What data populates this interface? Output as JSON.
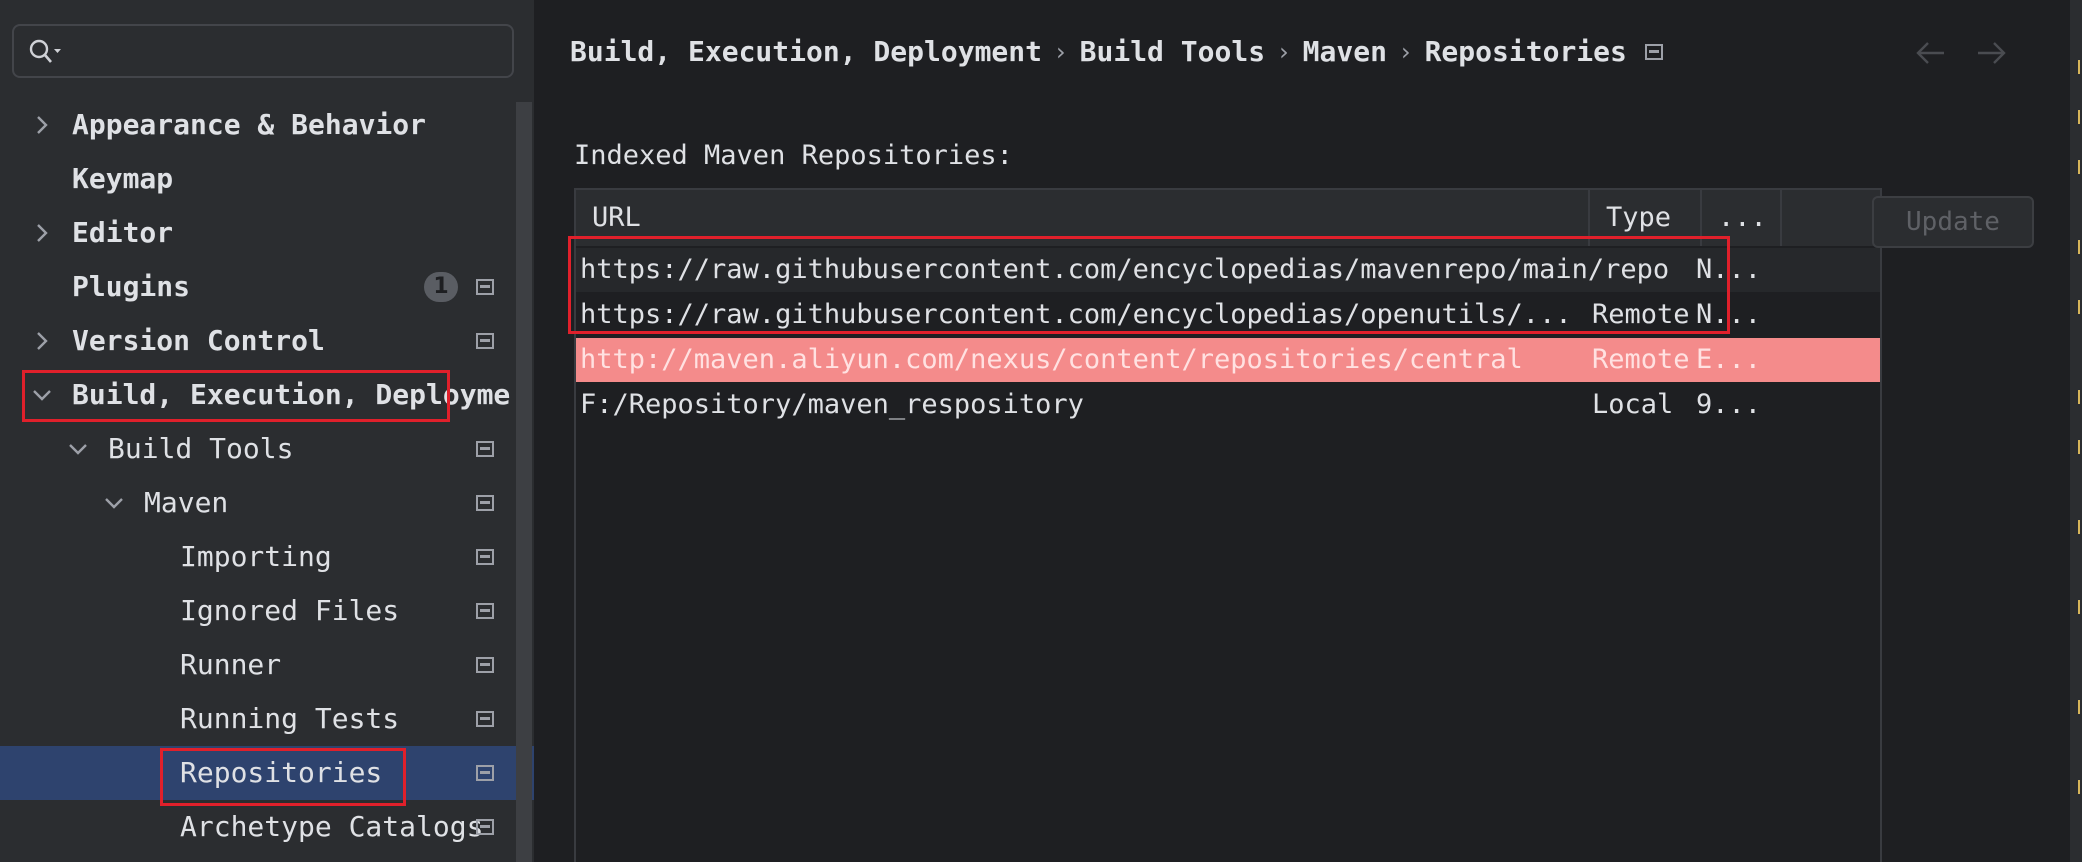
{
  "search": {
    "placeholder": ""
  },
  "tree": [
    {
      "label": "Appearance & Behavior",
      "bold": true,
      "chevron": "right",
      "level": 0
    },
    {
      "label": "Keymap",
      "bold": true,
      "chevron": "none",
      "level": 0
    },
    {
      "label": "Editor",
      "bold": true,
      "chevron": "right",
      "level": 0
    },
    {
      "label": "Plugins",
      "bold": true,
      "chevron": "none",
      "level": 0,
      "badge": "1",
      "pref": true
    },
    {
      "label": "Version Control",
      "bold": true,
      "chevron": "right",
      "level": 0,
      "pref": true
    },
    {
      "label": "Build, Execution, Deployme",
      "bold": true,
      "chevron": "down",
      "level": 0
    },
    {
      "label": "Build Tools",
      "bold": false,
      "chevron": "down",
      "level": 1,
      "pref": true
    },
    {
      "label": "Maven",
      "bold": false,
      "chevron": "down",
      "level": 2,
      "pref": true
    },
    {
      "label": "Importing",
      "bold": false,
      "chevron": "none",
      "level": 3,
      "pref": true
    },
    {
      "label": "Ignored Files",
      "bold": false,
      "chevron": "none",
      "level": 3,
      "pref": true
    },
    {
      "label": "Runner",
      "bold": false,
      "chevron": "none",
      "level": 3,
      "pref": true
    },
    {
      "label": "Running Tests",
      "bold": false,
      "chevron": "none",
      "level": 3,
      "pref": true
    },
    {
      "label": "Repositories",
      "bold": false,
      "chevron": "none",
      "level": 3,
      "pref": true,
      "selected": true
    },
    {
      "label": "Archetype Catalogs",
      "bold": false,
      "chevron": "none",
      "level": 3,
      "pref": true
    }
  ],
  "breadcrumb": [
    "Build, Execution, Deployment",
    "Build Tools",
    "Maven",
    "Repositories"
  ],
  "section_label": "Indexed Maven Repositories:",
  "table": {
    "headers": [
      "URL",
      "Type",
      "..."
    ],
    "rows": [
      {
        "url": "https://raw.githubusercontent.com/encyclopedias/mavenrepo/main/repo",
        "type": "",
        "status": "N...",
        "style": "alt"
      },
      {
        "url": "https://raw.githubusercontent.com/encyclopedias/openutils/...",
        "type": "Remote",
        "status": "N...",
        "style": "normal"
      },
      {
        "url": "http://maven.aliyun.com/nexus/content/repositories/central",
        "type": "Remote",
        "status": "E...",
        "style": "error"
      },
      {
        "url": "F:/Repository/maven_respository",
        "type": "Local",
        "status": "9...",
        "style": "normal"
      }
    ]
  },
  "update_button": "Update",
  "colors": {
    "selection": "#2e436e",
    "error_row": "#f48b8b",
    "highlight_box": "#e0202b"
  }
}
